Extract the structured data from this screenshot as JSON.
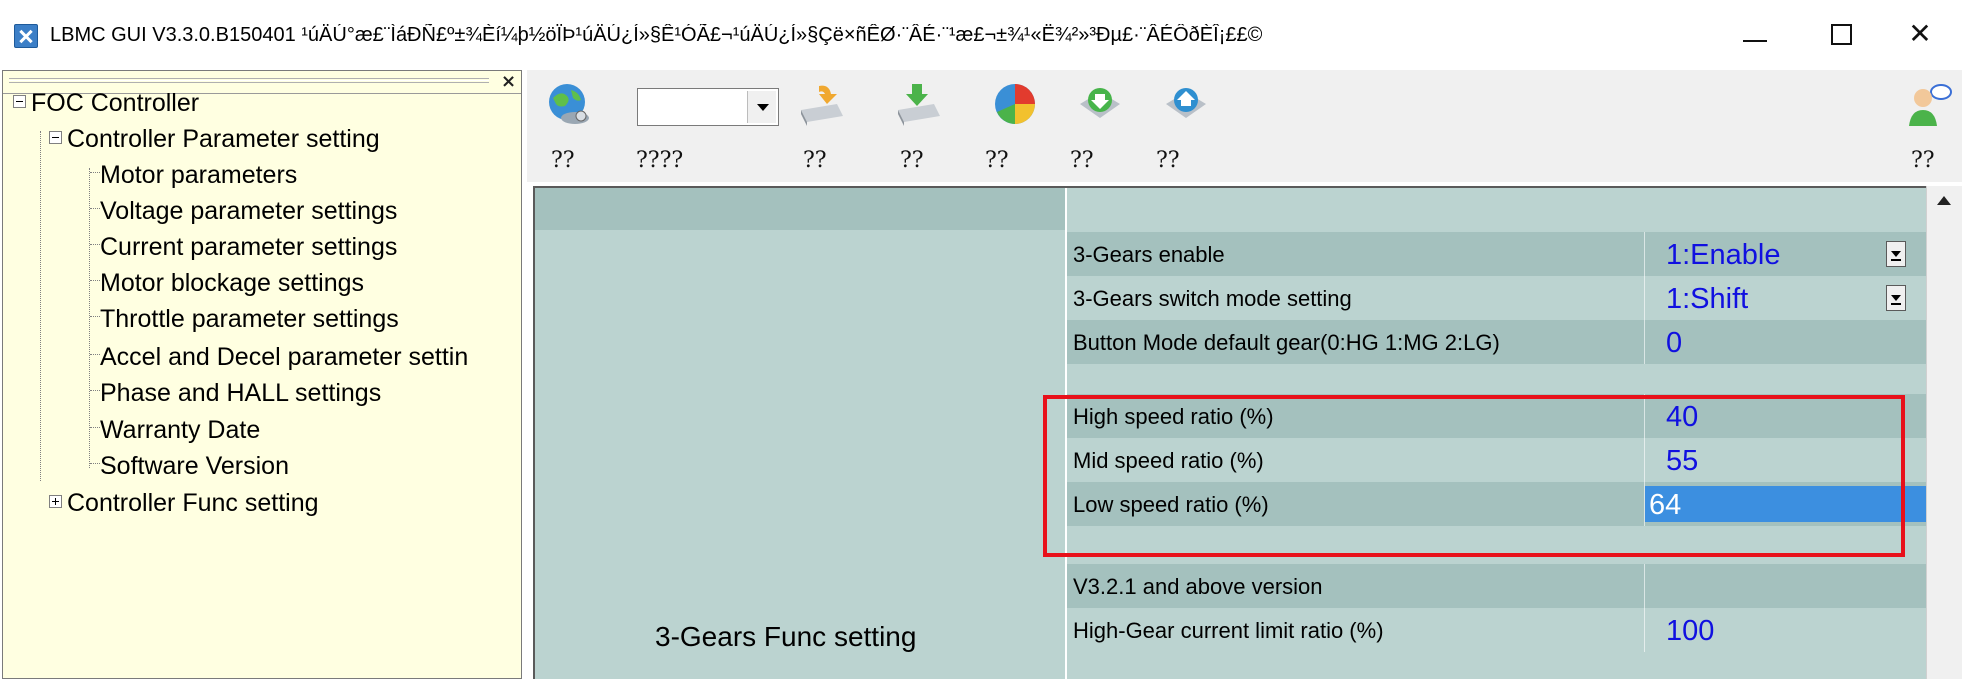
{
  "window": {
    "title": "LBMC GUI V3.3.0.B150401 ¹úÄÚ°æ£¨ÌáÐÑ£º±¾Èí¼þ½öÏÞ¹úÄÚ¿Í»§Ê¹ÓÃ£¬¹úÄÚ¿Í»§Çë×ñÊØ·¨ÂÉ·¨¹æ£¬±¾¹«Ë¾²»³Ðµ£·¨ÂÉÔðÈÎ¡££©",
    "controls": [
      "minimize",
      "maximize",
      "close"
    ]
  },
  "tree": {
    "close_label": "×",
    "root": "FOC Controller",
    "groups": [
      {
        "label": "Controller Parameter setting",
        "expanded": true,
        "items": [
          "Motor parameters",
          "Voltage parameter settings",
          "Current parameter settings",
          "Motor blockage settings",
          "Throttle parameter settings",
          "Accel and Decel parameter settin",
          "Phase and HALL settings",
          "Warranty Date",
          "Software Version"
        ]
      },
      {
        "label": "Controller Func setting",
        "expanded": false
      }
    ]
  },
  "toolbar": {
    "labels": [
      "??",
      "????",
      "??",
      "??",
      "??",
      "??",
      "??",
      "??"
    ],
    "combo_value": "",
    "icons": [
      "globe-connect-icon",
      "folder-open-icon",
      "folder-save-icon",
      "pie-chart-icon",
      "download-icon",
      "upload-icon",
      "user-icon"
    ]
  },
  "grid": {
    "category_label": "3-Gears Func setting",
    "rows": [
      {
        "name": "",
        "value": ""
      },
      {
        "name": "3-Gears enable",
        "value": "1:Enable",
        "dropdown": true
      },
      {
        "name": "3-Gears switch mode setting",
        "value": "1:Shift",
        "dropdown": true
      },
      {
        "name": "Button Mode default gear(0:HG 1:MG 2:LG)",
        "value": "0"
      },
      {
        "name": "",
        "value": ""
      },
      {
        "name": "High speed ratio (%)",
        "value": "40"
      },
      {
        "name": "Mid speed ratio (%)",
        "value": "55"
      },
      {
        "name": "Low speed ratio (%)",
        "value": "64",
        "selected": true
      },
      {
        "name": "",
        "value": ""
      },
      {
        "name": "V3.2.1 and above version",
        "value": ""
      },
      {
        "name": "High-Gear current limit ratio (%)",
        "value": "100"
      }
    ]
  },
  "colors": {
    "tree_bg": "#ffffe1",
    "row_dark": "#a4c1be",
    "row_light": "#bbd3d0",
    "value_text": "#1010e0",
    "selection": "#3c8fe0",
    "highlight_box": "#e8101a"
  }
}
